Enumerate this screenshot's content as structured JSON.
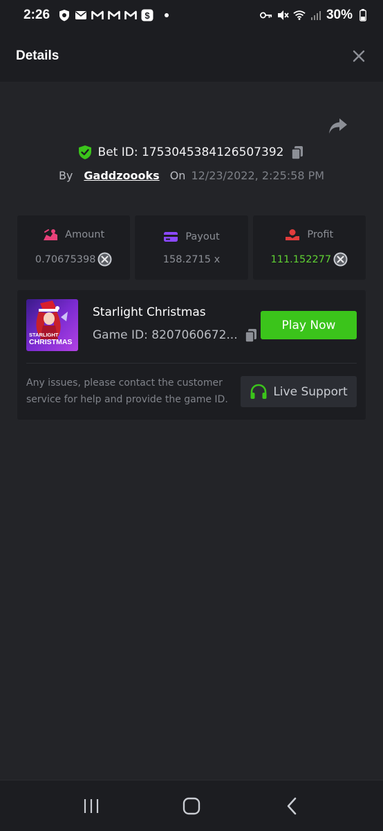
{
  "status_bar": {
    "time": "2:26",
    "battery": "30%",
    "icons": [
      "shield-icon",
      "mail-icon",
      "gmail-icon",
      "gmail-icon",
      "gmail-icon",
      "cash-app-icon",
      "key-icon",
      "mute-icon",
      "wifi-icon",
      "signal-icon",
      "battery-icon"
    ]
  },
  "header": {
    "title": "Details"
  },
  "bet": {
    "id_text": "Bet ID: 1753045384126507392",
    "by_label": "By",
    "user": "Gaddzoooks",
    "on_label": "On",
    "date": "12/23/2022, 2:25:58 PM"
  },
  "stats": [
    {
      "label": "Amount",
      "value": "0.70675398",
      "icon": "amount-icon",
      "color": "#e8417a"
    },
    {
      "label": "Payout",
      "value": "158.2715 x",
      "icon": "card-icon",
      "color": "#8b48ff"
    },
    {
      "label": "Profit",
      "value": "111.152277",
      "icon": "profit-icon",
      "color": "#e23c3c",
      "value_color": "#5fd033"
    }
  ],
  "game": {
    "name": "Starlight Christmas",
    "id": "Game ID: 8207060672...",
    "thumb_text_top": "STARLIGHT",
    "thumb_text_bottom": "CHRISTMAS",
    "play_label": "Play Now",
    "issues_text": "Any issues, please contact the customer service for help and provide the game ID.",
    "support_label": "Live Support"
  },
  "colors": {
    "background": "#232428",
    "panel": "#1c1d21",
    "accent_green": "#3bc41b"
  }
}
